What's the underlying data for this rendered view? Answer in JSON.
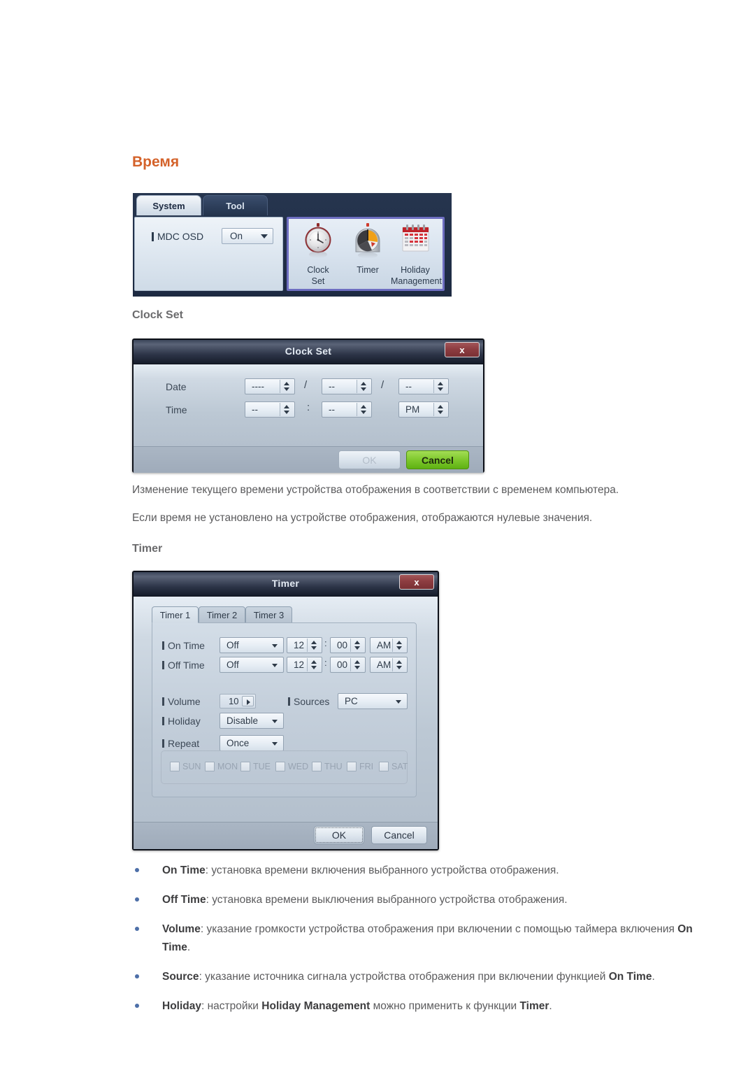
{
  "page": {
    "heading": "Время",
    "section_clock_set": "Clock Set",
    "section_timer": "Timer",
    "paragraph_1": "Изменение текущего времени устройства отображения в соответствии с временем компьютера.",
    "paragraph_2": "Если время не установлено на устройстве отображения, отображаются нулевые значения.",
    "heading_color": "#d4622a",
    "bullet_color": "#4d6fa8"
  },
  "mdc_panel": {
    "tabs": [
      {
        "label": "System",
        "active": true
      },
      {
        "label": "Tool",
        "active": false
      }
    ],
    "osd": {
      "label": "MDC OSD",
      "value": "On"
    },
    "icons": [
      {
        "name": "clock-set",
        "label_line1": "Clock",
        "label_line2": "Set"
      },
      {
        "name": "timer",
        "label_line1": "Timer",
        "label_line2": ""
      },
      {
        "name": "holiday-management",
        "label_line1": "Holiday",
        "label_line2": "Management"
      }
    ],
    "selection_border_color": "#6e6ec1"
  },
  "clock_set_dialog": {
    "title": "Clock Set",
    "close_label": "x",
    "rows": [
      {
        "label": "Date",
        "fields": [
          {
            "name": "year",
            "value": "----"
          },
          {
            "name": "month",
            "value": "--"
          },
          {
            "name": "day",
            "value": "--"
          }
        ],
        "separators": [
          "/",
          "/"
        ]
      },
      {
        "label": "Time",
        "fields": [
          {
            "name": "hour",
            "value": "--"
          },
          {
            "name": "minute",
            "value": "--"
          },
          {
            "name": "meridiem",
            "value": "PM"
          }
        ],
        "separators": [
          ":",
          ""
        ]
      }
    ],
    "buttons": {
      "ok": "OK",
      "cancel": "Cancel",
      "ok_enabled": false
    }
  },
  "timer_dialog": {
    "title": "Timer",
    "close_label": "x",
    "tabs": [
      {
        "label": "Timer 1",
        "active": true
      },
      {
        "label": "Timer 2",
        "active": false
      },
      {
        "label": "Timer 3",
        "active": false
      }
    ],
    "on_time": {
      "label": "On Time",
      "mode": "Off",
      "hour": "12",
      "minute": "00",
      "meridiem": "AM",
      "separator": ":"
    },
    "off_time": {
      "label": "Off Time",
      "mode": "Off",
      "hour": "12",
      "minute": "00",
      "meridiem": "AM",
      "separator": ":"
    },
    "volume": {
      "label": "Volume",
      "value": "10"
    },
    "sources": {
      "label": "Sources",
      "value": "PC"
    },
    "holiday": {
      "label": "Holiday",
      "value": "Disable"
    },
    "repeat": {
      "label": "Repeat",
      "value": "Once"
    },
    "days": [
      {
        "label": "SUN",
        "checked": false
      },
      {
        "label": "MON",
        "checked": false
      },
      {
        "label": "TUE",
        "checked": false
      },
      {
        "label": "WED",
        "checked": false
      },
      {
        "label": "THU",
        "checked": false
      },
      {
        "label": "FRI",
        "checked": false
      },
      {
        "label": "SAT",
        "checked": false
      }
    ],
    "buttons": {
      "ok": "OK",
      "cancel": "Cancel"
    }
  },
  "bullets": [
    {
      "term": "On Time",
      "rest": ": установка времени включения выбранного устройства отображения."
    },
    {
      "term": "Off Time",
      "rest": ": установка времени выключения выбранного устройства отображения."
    },
    {
      "term": "Volume",
      "rest": ": указание громкости устройства отображения при включении с помощью таймера включения ",
      "term2": "On Time",
      "tail": "."
    },
    {
      "term": "Source",
      "rest": ": указание источника сигнала устройства отображения при включении функцией ",
      "term2": "On Time",
      "tail": "."
    },
    {
      "term": "Holiday",
      "rest": ": настройки ",
      "term2": "Holiday Management",
      "rest2": " можно применить к функции ",
      "term3": "Timer",
      "tail": "."
    }
  ]
}
